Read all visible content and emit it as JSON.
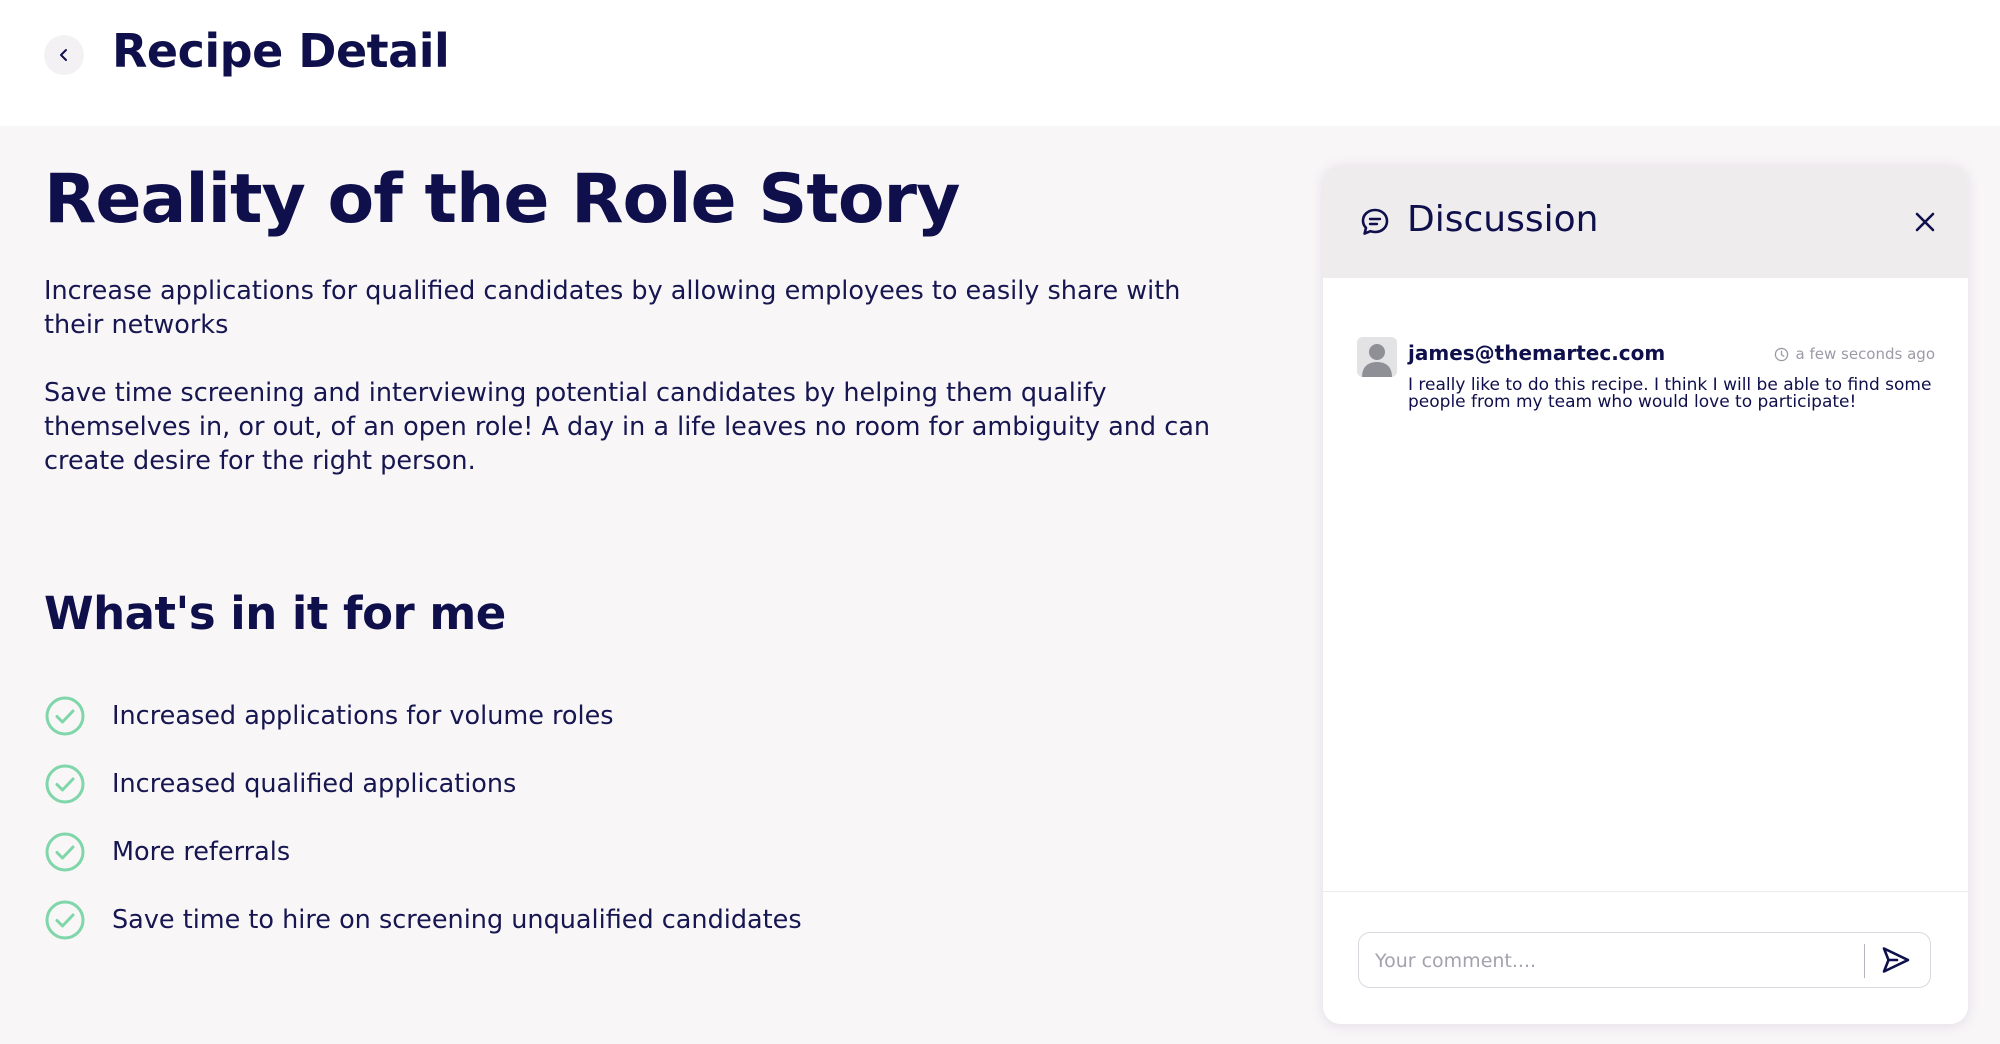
{
  "header": {
    "title": "Recipe Detail",
    "back_icon": "chevron-left-icon"
  },
  "recipe": {
    "title": "Reality of the Role Story",
    "descriptions": [
      "Increase applications for qualified candidates by allowing employees to easily share with their networks",
      "Save time screening and interviewing potential candidates by helping them qualify themselves in, or out, of an open role! A day in a life leaves no room for ambiguity and can create desire for the right person."
    ],
    "benefits_title": "What's in it for me",
    "benefits": [
      "Increased applications for volume roles",
      "Increased qualified applications",
      "More referrals",
      "Save time to hire on screening unqualified candidates"
    ]
  },
  "discussion": {
    "title": "Discussion",
    "comments": [
      {
        "author": "james@themartec.com",
        "time": "a few seconds ago",
        "text": "I really like to do this recipe. I think I will be able to find some people from my team who would love to participate!"
      }
    ],
    "input_placeholder": "Your comment....",
    "input_value": ""
  },
  "colors": {
    "navy": "#0f0f4b",
    "page_bg": "#f9f6f8",
    "panel_header_bg": "#efecee",
    "check_green": "#7fd6a8",
    "muted_text": "#9b9ba8"
  }
}
